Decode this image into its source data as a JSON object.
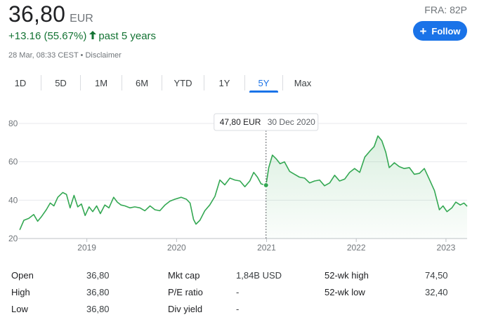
{
  "header": {
    "price": "36,80",
    "currency": "EUR",
    "ticker": "FRA: 82P",
    "follow_label": "Follow",
    "change": "+13.16 (55.67%)",
    "change_arrow": "🡑",
    "period": "past 5 years",
    "timestamp": "28 Mar, 08:33 CEST",
    "separator": "•",
    "disclaimer": "Disclaimer"
  },
  "tabs": [
    {
      "label": "1D"
    },
    {
      "label": "5D"
    },
    {
      "label": "1M"
    },
    {
      "label": "6M"
    },
    {
      "label": "YTD"
    },
    {
      "label": "1Y"
    },
    {
      "label": "5Y",
      "active": true
    },
    {
      "label": "Max"
    }
  ],
  "tooltip": {
    "value": "47,80 EUR",
    "date": "30 Dec 2020"
  },
  "colors": {
    "accent": "#1a73e8",
    "positive": "#137333",
    "line": "#34a853",
    "grid": "#e8eaed",
    "axis_text": "#70757a"
  },
  "chart_data": {
    "type": "line",
    "title": "",
    "xlabel": "",
    "ylabel": "",
    "ylim": [
      20,
      80
    ],
    "y_ticks": [
      "80",
      "60",
      "40",
      "20"
    ],
    "x_ticks": [
      "2019",
      "2020",
      "2021",
      "2022",
      "2023"
    ],
    "grid": true,
    "highlight": {
      "x": "2020-12-30",
      "y": 47.8
    },
    "series": [
      {
        "points": [
          [
            "2018-04-03",
            24.5
          ],
          [
            "2018-04-20",
            29.5
          ],
          [
            "2018-05-10",
            30.5
          ],
          [
            "2018-05-30",
            32.5
          ],
          [
            "2018-06-15",
            29.0
          ],
          [
            "2018-07-01",
            31.5
          ],
          [
            "2018-07-20",
            35.0
          ],
          [
            "2018-08-05",
            38.5
          ],
          [
            "2018-08-20",
            37.0
          ],
          [
            "2018-09-05",
            41.5
          ],
          [
            "2018-09-25",
            44.0
          ],
          [
            "2018-10-10",
            43.0
          ],
          [
            "2018-10-25",
            36.0
          ],
          [
            "2018-11-10",
            42.5
          ],
          [
            "2018-11-25",
            36.5
          ],
          [
            "2018-12-10",
            38.0
          ],
          [
            "2018-12-25",
            32.0
          ],
          [
            "2019-01-10",
            36.5
          ],
          [
            "2019-01-25",
            34.0
          ],
          [
            "2019-02-10",
            37.0
          ],
          [
            "2019-02-25",
            33.0
          ],
          [
            "2019-03-15",
            37.5
          ],
          [
            "2019-04-01",
            36.0
          ],
          [
            "2019-04-20",
            41.5
          ],
          [
            "2019-05-05",
            39.0
          ],
          [
            "2019-05-20",
            37.5
          ],
          [
            "2019-06-05",
            37.0
          ],
          [
            "2019-06-25",
            36.0
          ],
          [
            "2019-07-15",
            36.5
          ],
          [
            "2019-08-05",
            36.0
          ],
          [
            "2019-08-25",
            34.5
          ],
          [
            "2019-09-15",
            37.0
          ],
          [
            "2019-10-05",
            35.0
          ],
          [
            "2019-10-25",
            34.5
          ],
          [
            "2019-11-15",
            37.5
          ],
          [
            "2019-12-05",
            39.5
          ],
          [
            "2019-12-25",
            40.5
          ],
          [
            "2020-01-20",
            41.5
          ],
          [
            "2020-02-10",
            40.5
          ],
          [
            "2020-02-25",
            38.5
          ],
          [
            "2020-03-10",
            30.0
          ],
          [
            "2020-03-20",
            27.5
          ],
          [
            "2020-04-05",
            29.5
          ],
          [
            "2020-04-25",
            34.5
          ],
          [
            "2020-05-15",
            37.5
          ],
          [
            "2020-06-05",
            42.0
          ],
          [
            "2020-06-25",
            50.5
          ],
          [
            "2020-07-15",
            48.0
          ],
          [
            "2020-08-05",
            51.5
          ],
          [
            "2020-08-25",
            50.5
          ],
          [
            "2020-09-15",
            50.0
          ],
          [
            "2020-10-05",
            47.0
          ],
          [
            "2020-10-25",
            50.0
          ],
          [
            "2020-11-10",
            54.5
          ],
          [
            "2020-11-25",
            52.0
          ],
          [
            "2020-12-10",
            48.5
          ],
          [
            "2020-12-30",
            47.8
          ],
          [
            "2021-01-10",
            57.0
          ],
          [
            "2021-01-25",
            63.5
          ],
          [
            "2021-02-10",
            61.5
          ],
          [
            "2021-02-25",
            59.0
          ],
          [
            "2021-03-15",
            60.0
          ],
          [
            "2021-04-05",
            55.0
          ],
          [
            "2021-04-25",
            53.5
          ],
          [
            "2021-05-15",
            52.0
          ],
          [
            "2021-06-05",
            51.5
          ],
          [
            "2021-06-25",
            49.0
          ],
          [
            "2021-07-15",
            50.0
          ],
          [
            "2021-08-05",
            50.5
          ],
          [
            "2021-08-25",
            47.5
          ],
          [
            "2021-09-15",
            49.0
          ],
          [
            "2021-10-05",
            53.0
          ],
          [
            "2021-10-25",
            50.0
          ],
          [
            "2021-11-15",
            51.0
          ],
          [
            "2021-12-05",
            54.5
          ],
          [
            "2021-12-25",
            56.5
          ],
          [
            "2022-01-15",
            54.5
          ],
          [
            "2022-02-05",
            62.5
          ],
          [
            "2022-02-25",
            65.5
          ],
          [
            "2022-03-15",
            68.0
          ],
          [
            "2022-03-30",
            73.5
          ],
          [
            "2022-04-15",
            71.0
          ],
          [
            "2022-05-01",
            65.0
          ],
          [
            "2022-05-15",
            57.0
          ],
          [
            "2022-06-05",
            59.5
          ],
          [
            "2022-06-25",
            57.5
          ],
          [
            "2022-07-15",
            56.5
          ],
          [
            "2022-08-05",
            57.0
          ],
          [
            "2022-08-25",
            53.5
          ],
          [
            "2022-09-15",
            54.0
          ],
          [
            "2022-10-05",
            56.5
          ],
          [
            "2022-10-25",
            51.0
          ],
          [
            "2022-11-15",
            45.0
          ],
          [
            "2022-12-05",
            35.0
          ],
          [
            "2022-12-20",
            37.0
          ],
          [
            "2023-01-05",
            34.0
          ],
          [
            "2023-01-25",
            36.0
          ],
          [
            "2023-02-10",
            39.0
          ],
          [
            "2023-02-28",
            37.5
          ],
          [
            "2023-03-15",
            38.5
          ],
          [
            "2023-03-28",
            36.8
          ]
        ]
      }
    ]
  },
  "stats": {
    "col1": [
      {
        "label": "Open",
        "value": "36,80"
      },
      {
        "label": "High",
        "value": "36,80"
      },
      {
        "label": "Low",
        "value": "36,80"
      }
    ],
    "col2": [
      {
        "label": "Mkt cap",
        "value": "1,84B USD"
      },
      {
        "label": "P/E ratio",
        "value": "-"
      },
      {
        "label": "Div yield",
        "value": "-"
      }
    ],
    "col3": [
      {
        "label": "52-wk high",
        "value": "74,50"
      },
      {
        "label": "52-wk low",
        "value": "32,40"
      }
    ]
  }
}
